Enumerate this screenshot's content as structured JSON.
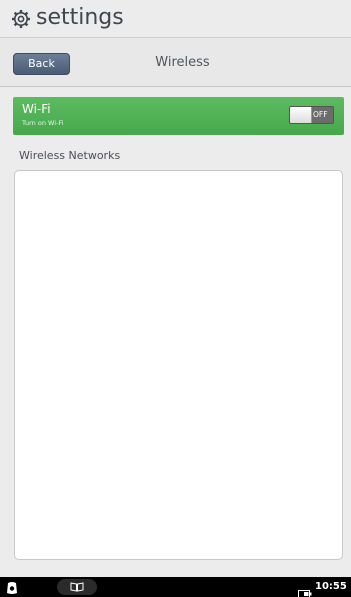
{
  "app": {
    "title": "settings",
    "icon": "gear-icon"
  },
  "header": {
    "back_label": "Back",
    "screen_title": "Wireless"
  },
  "wifi": {
    "label": "Wi-Fi",
    "sublabel": "Turn on Wi-Fi",
    "toggle_state": "OFF",
    "row_color": "#4caf50"
  },
  "networks": {
    "section_label": "Wireless Networks",
    "items": []
  },
  "system_bar": {
    "home_icon": "home-icon",
    "library_icon": "book-icon",
    "battery_icon": "battery-icon",
    "time": "10:55"
  }
}
